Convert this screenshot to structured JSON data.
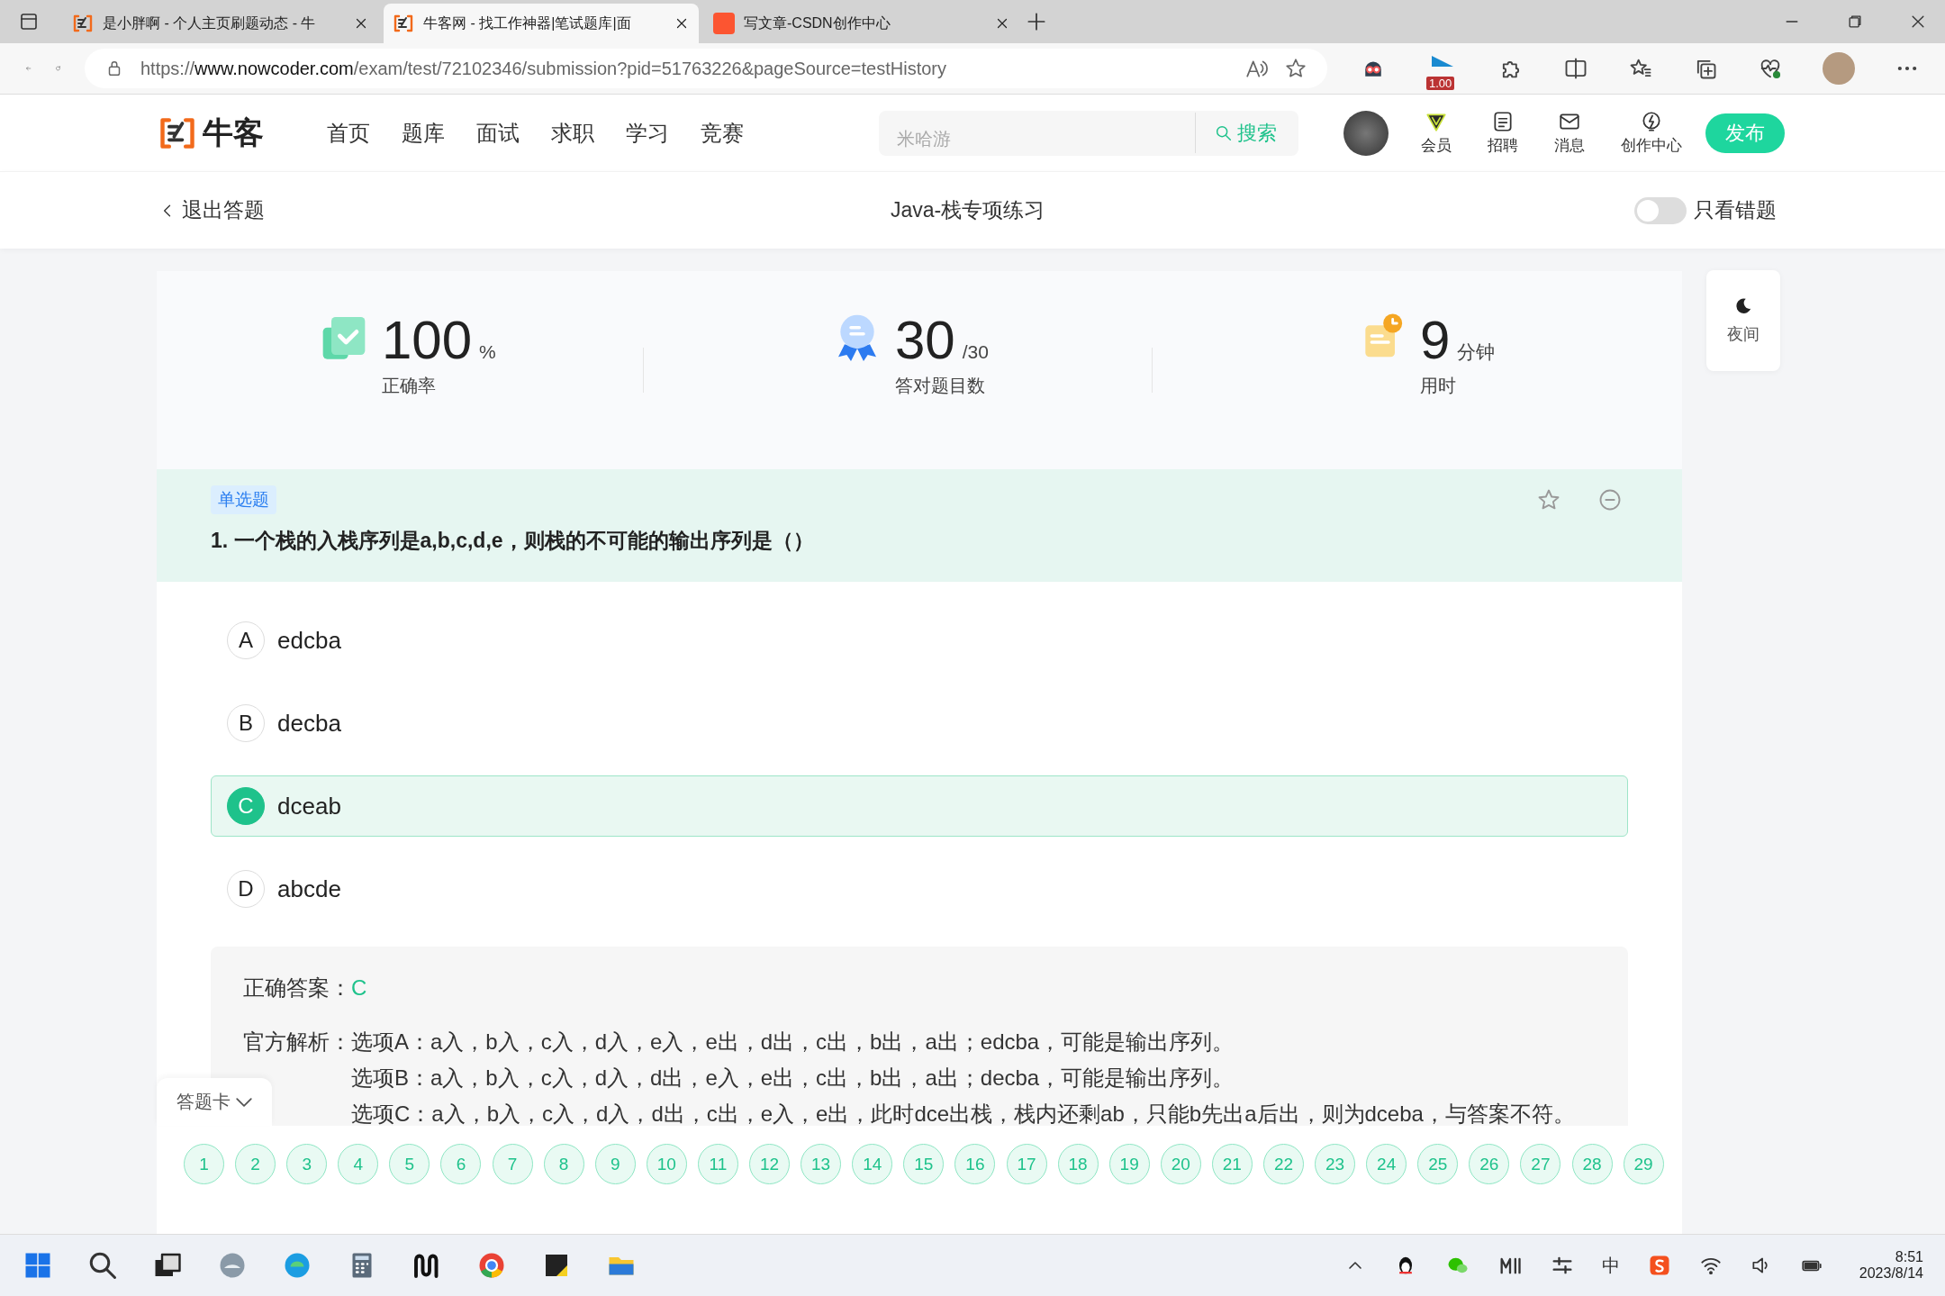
{
  "browser": {
    "tabs": [
      {
        "title": "是小胖啊 - 个人主页刷题动态 - 牛",
        "kind": "nowcoder",
        "selected": false
      },
      {
        "title": "牛客网 - 找工作神器|笔试题库|面",
        "kind": "nowcoder",
        "selected": true
      },
      {
        "title": "写文章-CSDN创作中心",
        "kind": "csdn",
        "selected": false
      }
    ],
    "url": {
      "scheme": "https://",
      "host": "www.nowcoder.com",
      "path": "/exam/test/72102346/submission?pid=51763226&pageSource=testHistory"
    },
    "extension_badge": "1.00"
  },
  "header": {
    "logo": "牛客",
    "nav": [
      "首页",
      "题库",
      "面试",
      "求职",
      "学习",
      "竞赛"
    ],
    "search": {
      "placeholder": "米哈游",
      "button": "搜索"
    },
    "icons": [
      {
        "label": "会员",
        "kind": "vip"
      },
      {
        "label": "招聘",
        "kind": "jobs"
      },
      {
        "label": "消息",
        "kind": "mail"
      },
      {
        "label": "创作中心",
        "kind": "create"
      }
    ],
    "publish": "发布"
  },
  "subheader": {
    "back": "退出答题",
    "title": "Java-栈专项练习",
    "toggle": {
      "label": "只看错题",
      "on": false
    }
  },
  "stats": [
    {
      "kind": "accuracy",
      "value": "100",
      "unit": "%",
      "label": "正确率"
    },
    {
      "kind": "count",
      "value": "30",
      "unit": "/30",
      "label": "答对题目数"
    },
    {
      "kind": "time",
      "value": "9",
      "unit": "分钟",
      "label": "用时"
    }
  ],
  "night_mode": "夜间",
  "question": {
    "type": "单选题",
    "title": "1. 一个栈的入栈序列是a,b,c,d,e，则栈的不可能的输出序列是（）",
    "options": [
      {
        "letter": "A",
        "text": "edcba",
        "correct": false
      },
      {
        "letter": "B",
        "text": "decba",
        "correct": false
      },
      {
        "letter": "C",
        "text": "dceab",
        "correct": true
      },
      {
        "letter": "D",
        "text": "abcde",
        "correct": false
      }
    ],
    "answer_label": "正确答案：",
    "answer": "C",
    "analysis_label": "官方解析：",
    "analysis": [
      "选项A：a入，b入，c入，d入，e入，e出，d出，c出，b出，a出；edcba，可能是输出序列。",
      "选项B：a入，b入，c入，d入，d出，e入，e出，c出，b出，a出；decba，可能是输出序列。",
      "选项C：a入，b入，c入，d入，d出，c出，e入，e出，此时dce出栈，栈内还剩ab，只能b先出a后出，则为dceba，与答案不符。"
    ]
  },
  "answer_card": {
    "label": "答题卡",
    "numbers": [
      "1",
      "2",
      "3",
      "4",
      "5",
      "6",
      "7",
      "8",
      "9",
      "10",
      "11",
      "12",
      "13",
      "14",
      "15",
      "16",
      "17",
      "18",
      "19",
      "20",
      "21",
      "22",
      "23",
      "24",
      "25",
      "26",
      "27",
      "28",
      "29"
    ]
  },
  "taskbar": {
    "ime": "中",
    "time": "8:51",
    "date": "2023/8/14"
  }
}
